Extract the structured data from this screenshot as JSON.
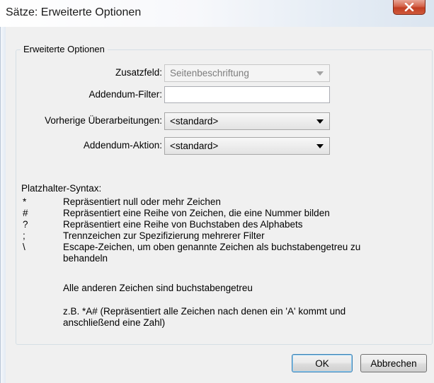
{
  "window": {
    "title": "Sätze: Erweiterte Optionen",
    "close_icon": "close-x-icon"
  },
  "group": {
    "title": "Erweiterte Optionen"
  },
  "fields": {
    "zusatzfeld": {
      "label": "Zusatzfeld:",
      "value": "Seitenbeschriftung",
      "disabled": true
    },
    "addendum_filter": {
      "label": "Addendum-Filter:",
      "value": ""
    },
    "vorherige": {
      "label": "Vorherige Überarbeitungen:",
      "value": "<standard>"
    },
    "addendum_aktion": {
      "label": "Addendum-Aktion:",
      "value": "<standard>"
    }
  },
  "syntax": {
    "heading": "Platzhalter-Syntax:",
    "rows": [
      {
        "symbol": "*",
        "text": "Repräsentiert null oder mehr Zeichen"
      },
      {
        "symbol": "#",
        "text": "Repräsentiert eine Reihe von Zeichen, die eine Nummer bilden"
      },
      {
        "symbol": "?",
        "text": "Repräsentiert eine Reihe von Buchstaben des Alphabets"
      },
      {
        "symbol": ";",
        "text": "Trennzeichen zur Spezifizierung mehrerer Filter"
      },
      {
        "symbol": "\\",
        "text": "Escape-Zeichen, um oben genannte Zeichen als buchstabengetreu zu behandeln"
      }
    ],
    "note_literal": "Alle anderen Zeichen sind buchstabengetreu",
    "note_example": "z.B. *A# (Repräsentiert alle Zeichen nach denen ein 'A' kommt und anschließend eine Zahl)"
  },
  "buttons": {
    "ok": "OK",
    "cancel": "Abbrechen"
  },
  "colors": {
    "close_button": "#c7462a",
    "dialog_background": "#f0f0f0",
    "default_button_border": "#3c7fb1"
  }
}
